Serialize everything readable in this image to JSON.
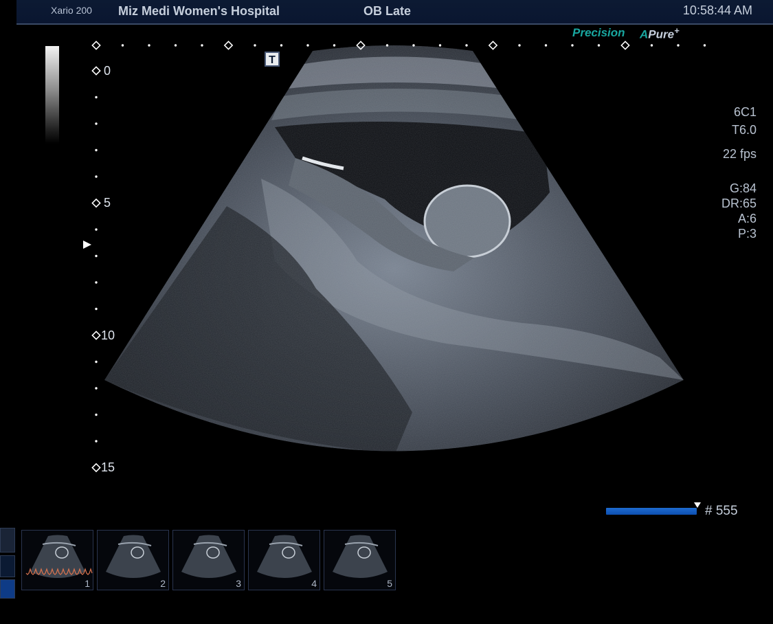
{
  "header": {
    "device": "Xario 200",
    "hospital": "Miz Medi Women's Hospital",
    "preset": "OB Late",
    "time": "10:58:44 AM"
  },
  "badges": {
    "precision": "Precision",
    "apure_a": "A",
    "apure_text": "Pure",
    "apure_plus": "+"
  },
  "overlay": {
    "t_marker": "T"
  },
  "depth_scale": {
    "labels": [
      "0",
      "5",
      "10",
      "15"
    ]
  },
  "image_params": {
    "probe": "6C1",
    "thi": "T6.0",
    "fps": "22 fps",
    "gain": "G:84",
    "dynamic_range": "DR:65",
    "a": "A:6",
    "p": "P:3"
  },
  "cine": {
    "frame_count": "# 555"
  },
  "thumbnails": [
    {
      "number": "1"
    },
    {
      "number": "2"
    },
    {
      "number": "3"
    },
    {
      "number": "4"
    },
    {
      "number": "5"
    }
  ],
  "colors": {
    "header_bg": "#0c1a33",
    "accent_teal": "#19a7a0",
    "cine_bar": "#1e6bd0",
    "ecg_trace": "#d9734f"
  }
}
